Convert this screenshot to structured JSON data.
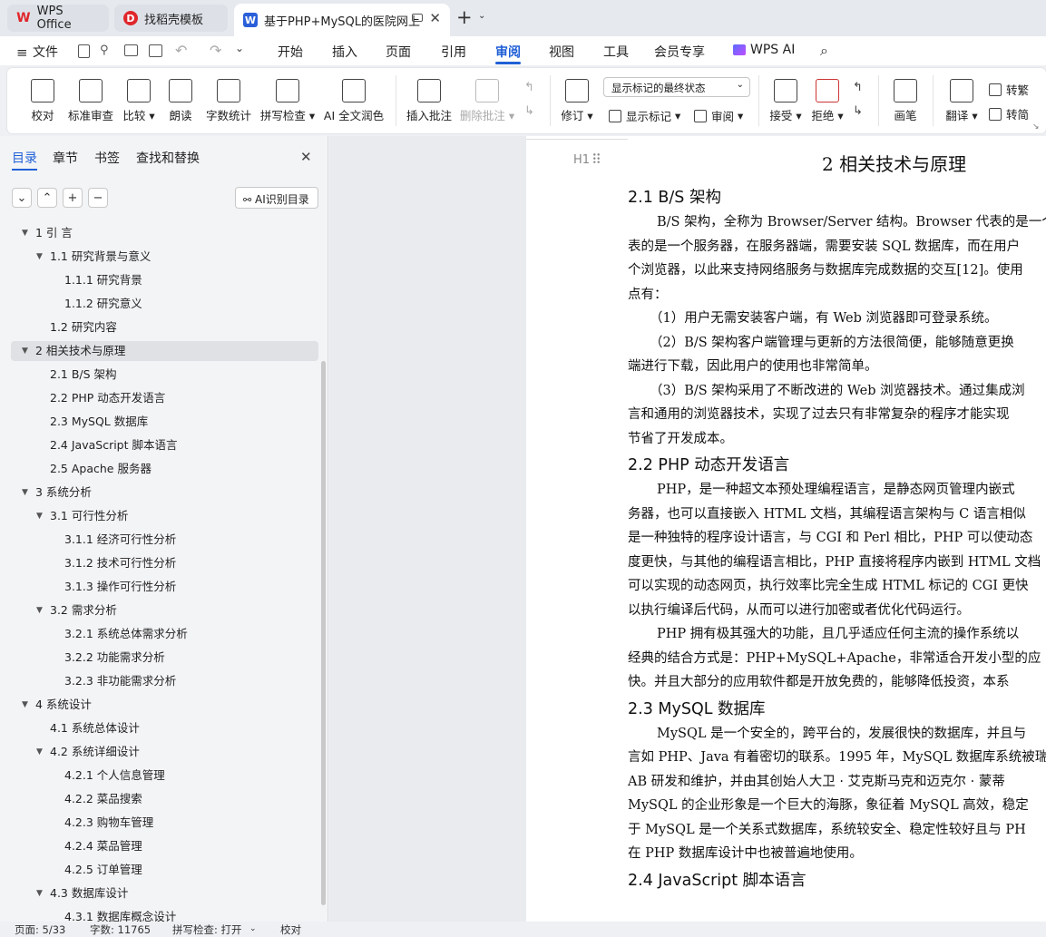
{
  "tabs": [
    {
      "label": "WPS Office",
      "icon": "wps-logo",
      "color": "#e0262b"
    },
    {
      "label": "找稻壳模板",
      "icon": "docer-logo",
      "color": "#e0262b"
    },
    {
      "label": "基于PHP+MySQL的医院网上",
      "icon": "word-doc-icon",
      "color": "#2b5fd9"
    }
  ],
  "menu": {
    "file": "文件",
    "items": [
      "开始",
      "插入",
      "页面",
      "引用",
      "审阅",
      "视图",
      "工具",
      "会员专享"
    ],
    "active": "审阅",
    "ai": "WPS AI"
  },
  "ribbon": {
    "buttons": [
      "校对",
      "标准审查",
      "比较",
      "朗读",
      "字数统计",
      "拼写检查",
      "AI 全文润色",
      "插入批注",
      "删除批注",
      "修订",
      "接受",
      "拒绝",
      "画笔",
      "翻译"
    ],
    "markup_select": "显示标记的最终状态",
    "show_markup": "显示标记",
    "review": "审阅",
    "trad": "转繁",
    "simp": "转简"
  },
  "left_panel": {
    "tabs": [
      "目录",
      "章节",
      "书签",
      "查找和替换"
    ],
    "ai_button": "AI识别目录",
    "toc": [
      {
        "level": 1,
        "text": "1  引  言",
        "expand": "open"
      },
      {
        "level": 2,
        "text": "1.1  研究背景与意义",
        "expand": "open"
      },
      {
        "level": 3,
        "text": "1.1.1  研究背景"
      },
      {
        "level": 3,
        "text": "1.1.2  研究意义"
      },
      {
        "level": 2,
        "text": "1.2  研究内容"
      },
      {
        "level": 1,
        "text": "2  相关技术与原理",
        "expand": "open",
        "selected": true
      },
      {
        "level": 2,
        "text": "2.1 B/S 架构"
      },
      {
        "level": 2,
        "text": "2.2 PHP 动态开发语言"
      },
      {
        "level": 2,
        "text": "2.3 MySQL 数据库"
      },
      {
        "level": 2,
        "text": "2.4 JavaScript 脚本语言"
      },
      {
        "level": 2,
        "text": "2.5 Apache 服务器"
      },
      {
        "level": 1,
        "text": "3  系统分析",
        "expand": "open"
      },
      {
        "level": 2,
        "text": "3.1  可行性分析",
        "expand": "open"
      },
      {
        "level": 3,
        "text": "3.1.1  经济可行性分析"
      },
      {
        "level": 3,
        "text": "3.1.2  技术可行性分析"
      },
      {
        "level": 3,
        "text": "3.1.3  操作可行性分析"
      },
      {
        "level": 2,
        "text": "3.2  需求分析",
        "expand": "open"
      },
      {
        "level": 3,
        "text": "3.2.1  系统总体需求分析"
      },
      {
        "level": 3,
        "text": "3.2.2  功能需求分析"
      },
      {
        "level": 3,
        "text": "3.2.3  非功能需求分析"
      },
      {
        "level": 1,
        "text": "4  系统设计",
        "expand": "open"
      },
      {
        "level": 2,
        "text": "4.1  系统总体设计"
      },
      {
        "level": 2,
        "text": "4.2  系统详细设计",
        "expand": "open"
      },
      {
        "level": 3,
        "text": "4.2.1  个人信息管理"
      },
      {
        "level": 3,
        "text": "4.2.2  菜品搜索"
      },
      {
        "level": 3,
        "text": "4.2.3  购物车管理"
      },
      {
        "level": 3,
        "text": "4.2.4  菜品管理"
      },
      {
        "level": 3,
        "text": "4.2.5  订单管理"
      },
      {
        "level": 2,
        "text": "4.3  数据库设计",
        "expand": "open"
      },
      {
        "level": 3,
        "text": "4.3.1  数据库概念设计"
      }
    ]
  },
  "document": {
    "chapter_title": "2  相关技术与原理",
    "heading_marker": "H1",
    "blocks": [
      {
        "type": "h",
        "text": "2.1 B/S 架构"
      },
      {
        "type": "p",
        "text": "B/S 架构，全称为 Browser/Server 结构。Browser 代表的是一个"
      },
      {
        "type": "p",
        "text": "表的是一个服务器，在服务器端，需要安装 SQL 数据库，而在用户"
      },
      {
        "type": "p",
        "text": "个浏览器，以此来支持网络服务与数据库完成数据的交互[12]。使用"
      },
      {
        "type": "p",
        "text": "点有："
      },
      {
        "type": "p",
        "text": "（1）用户无需安装客户端，有 Web 浏览器即可登录系统。"
      },
      {
        "type": "p",
        "text": "（2）B/S 架构客户端管理与更新的方法很简便，能够随意更换"
      },
      {
        "type": "p",
        "text": "端进行下载，因此用户的使用也非常简单。"
      },
      {
        "type": "p",
        "text": "（3）B/S 架构采用了不断改进的 Web 浏览器技术。通过集成浏"
      },
      {
        "type": "p",
        "text": "言和通用的浏览器技术，实现了过去只有非常复杂的程序才能实现"
      },
      {
        "type": "p",
        "text": "节省了开发成本。"
      },
      {
        "type": "h",
        "text": "2.2 PHP 动态开发语言"
      },
      {
        "type": "p",
        "text": "PHP，是一种超文本预处理编程语言，是静态网页管理内嵌式"
      },
      {
        "type": "p",
        "text": "务器，也可以直接嵌入 HTML 文档，其编程语言架构与 C 语言相似"
      },
      {
        "type": "p",
        "text": "是一种独特的程序设计语言，与 CGI 和 Perl 相比，PHP 可以使动态"
      },
      {
        "type": "p",
        "text": "度更快，与其他的编程语言相比，PHP 直接将程序内嵌到 HTML 文档"
      },
      {
        "type": "p",
        "text": "可以实现的动态网页，执行效率比完全生成 HTML 标记的 CGI 更快"
      },
      {
        "type": "p",
        "text": "以执行编译后代码，从而可以进行加密或者优化代码运行。"
      },
      {
        "type": "p",
        "text": "PHP 拥有极其强大的功能，且几乎适应任何主流的操作系统以"
      },
      {
        "type": "p",
        "text": "经典的结合方式是：PHP+MySQL+Apache，非常适合开发小型的应"
      },
      {
        "type": "p",
        "text": "快。并且大部分的应用软件都是开放免费的，能够降低投资，本系"
      },
      {
        "type": "h",
        "text": "2.3 MySQL 数据库"
      },
      {
        "type": "p",
        "text": "MySQL 是一个安全的，跨平台的，发展很快的数据库，并且与"
      },
      {
        "type": "p",
        "text": "言如 PHP、Java 有着密切的联系。1995 年，MySQL 数据库系统被瑞"
      },
      {
        "type": "p",
        "text": "AB 研发和维护，并由其创始人大卫 · 艾克斯马克和迈克尔 · 蒙蒂"
      },
      {
        "type": "p",
        "text": "MySQL 的企业形象是一个巨大的海豚，象征着 MySQL 高效，稳定"
      },
      {
        "type": "p",
        "text": "于 MySQL 是一个关系式数据库，系统较安全、稳定性较好且与 PH"
      },
      {
        "type": "p",
        "text": "在 PHP 数据库设计中也被普遍地使用。"
      },
      {
        "type": "h",
        "text": "2.4 JavaScript 脚本语言"
      }
    ]
  },
  "status": {
    "page": "页面: 5/33",
    "words": "字数: 11765",
    "spell": "拼写检查: 打开",
    "proof": "校对"
  }
}
